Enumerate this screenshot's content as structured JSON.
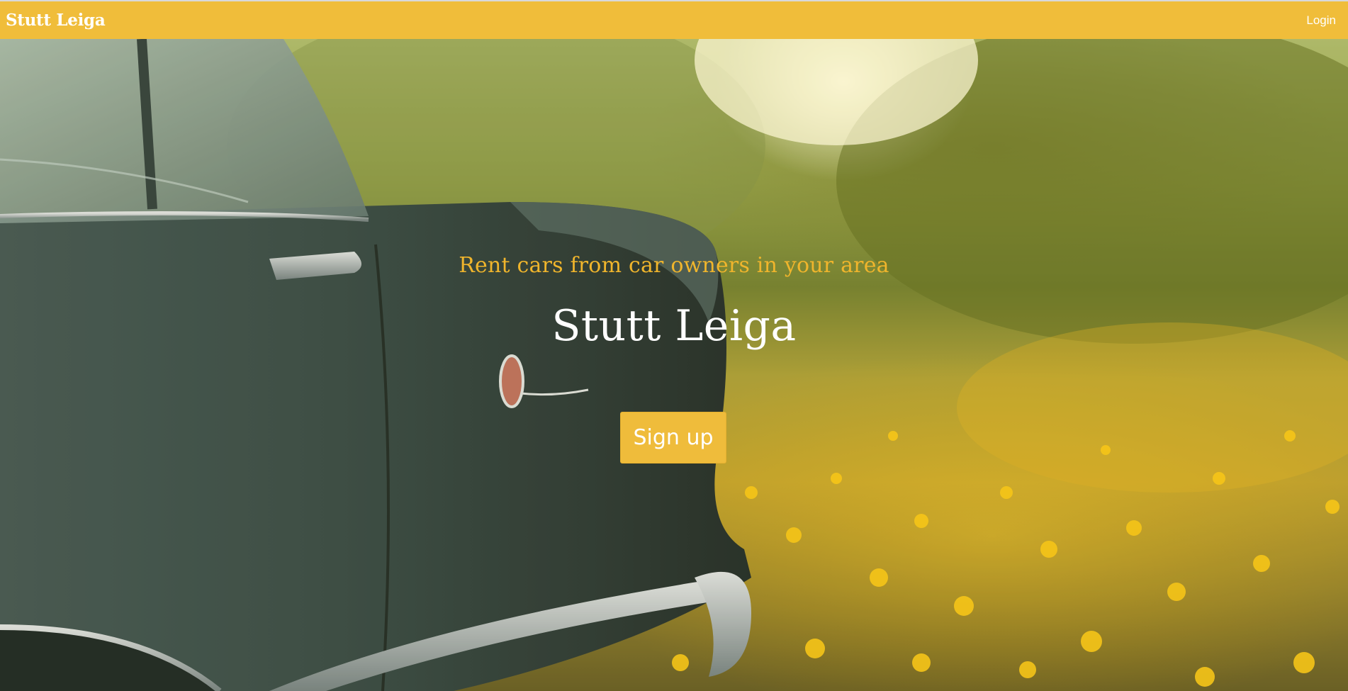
{
  "navbar": {
    "brand": "Stutt Leiga",
    "login_label": "Login"
  },
  "hero": {
    "tagline": "Rent cars from car owners in your area",
    "title": "Stutt Leiga",
    "signup_label": "Sign up",
    "background_image": "vintage-car-in-flower-field"
  },
  "colors": {
    "accent": "#f0bd3a",
    "tagline": "#f0b52c",
    "text_light": "#ffffff"
  }
}
